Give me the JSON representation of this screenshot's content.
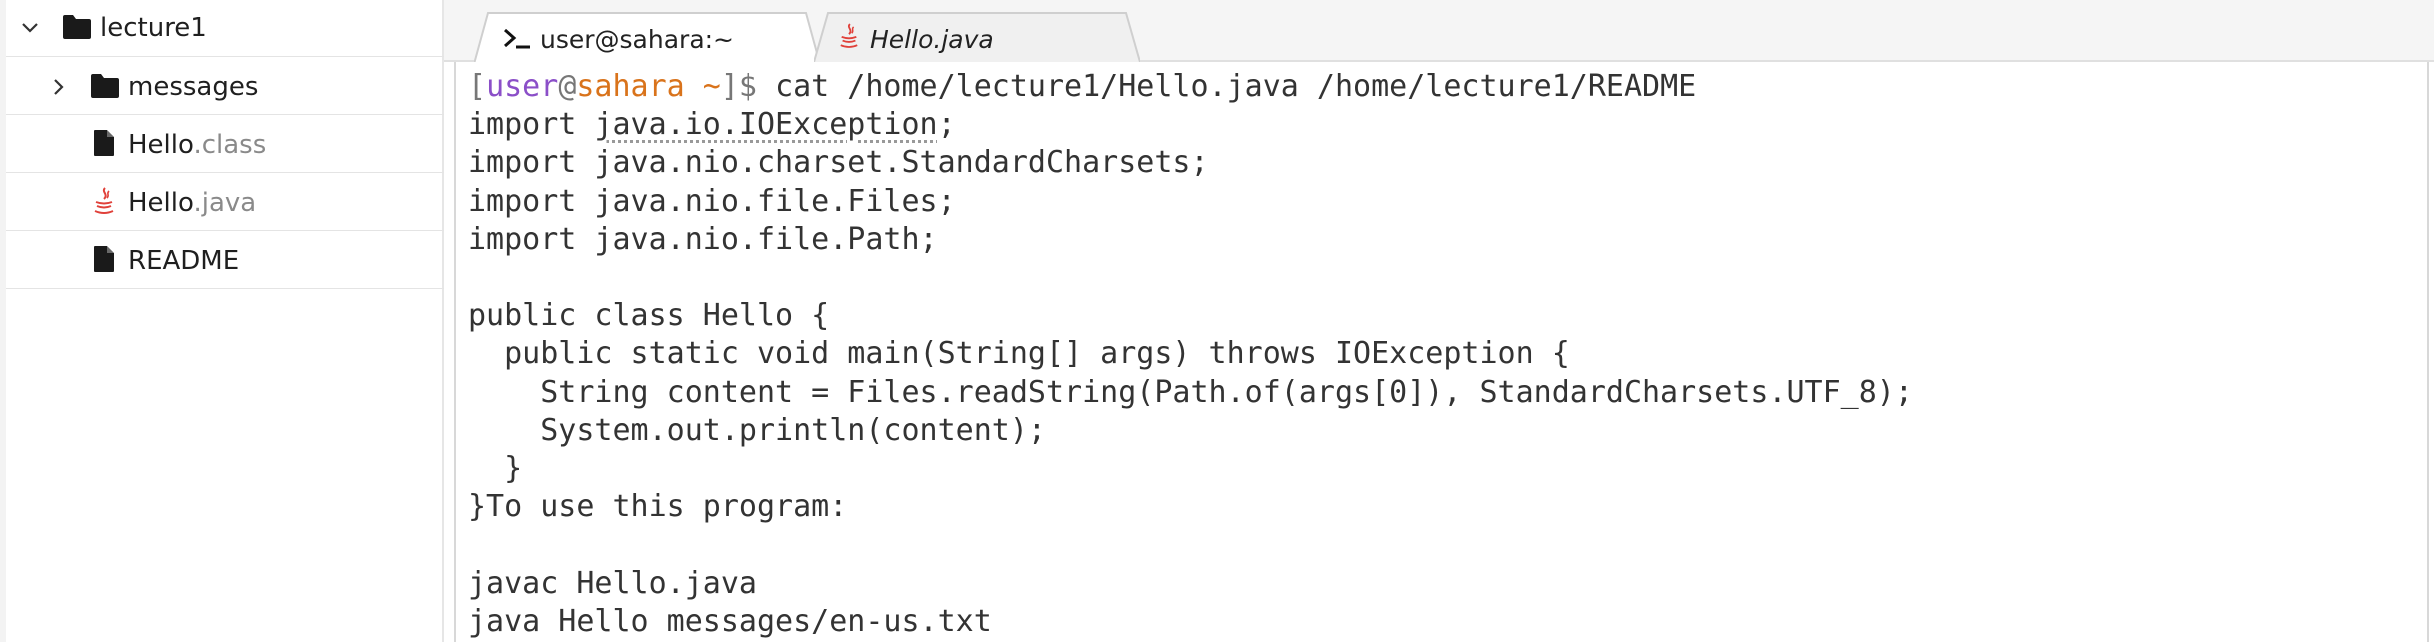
{
  "sidebar": {
    "root": {
      "label": "lecture1",
      "expanded": true
    },
    "items": [
      {
        "name": "messages",
        "type": "folder",
        "expanded": false
      },
      {
        "base": "Hello",
        "ext": ".class",
        "type": "file"
      },
      {
        "base": "Hello",
        "ext": ".java",
        "type": "java-file"
      },
      {
        "base": "README",
        "ext": "",
        "type": "file"
      }
    ]
  },
  "tabs": [
    {
      "label": "user@sahara:~",
      "icon": "terminal-icon",
      "active": true
    },
    {
      "label": "Hello.java",
      "icon": "java-icon",
      "active": false
    }
  ],
  "terminal": {
    "prompt": {
      "open_bracket": "[",
      "user": "user",
      "at": "@",
      "host": "sahara",
      "path": " ~",
      "close": "]$ "
    },
    "command": "cat /home/lecture1/Hello.java /home/lecture1/README",
    "import_keyword": "import ",
    "import_first_pkg": "java.io.IOException",
    "import_first_end": ";",
    "lines": [
      "import java.nio.charset.StandardCharsets;",
      "import java.nio.file.Files;",
      "import java.nio.file.Path;",
      "",
      "public class Hello {",
      "  public static void main(String[] args) throws IOException {",
      "    String content = Files.readString(Path.of(args[0]), StandardCharsets.UTF_8);",
      "    System.out.println(content);",
      "  }",
      "}To use this program:",
      "",
      "javac Hello.java",
      "java Hello messages/en-us.txt"
    ]
  },
  "colors": {
    "prompt_user": "#8b4fc8",
    "prompt_host": "#d9731b",
    "java_icon": "#e0413a",
    "folder_icon": "#1a1a1a"
  }
}
